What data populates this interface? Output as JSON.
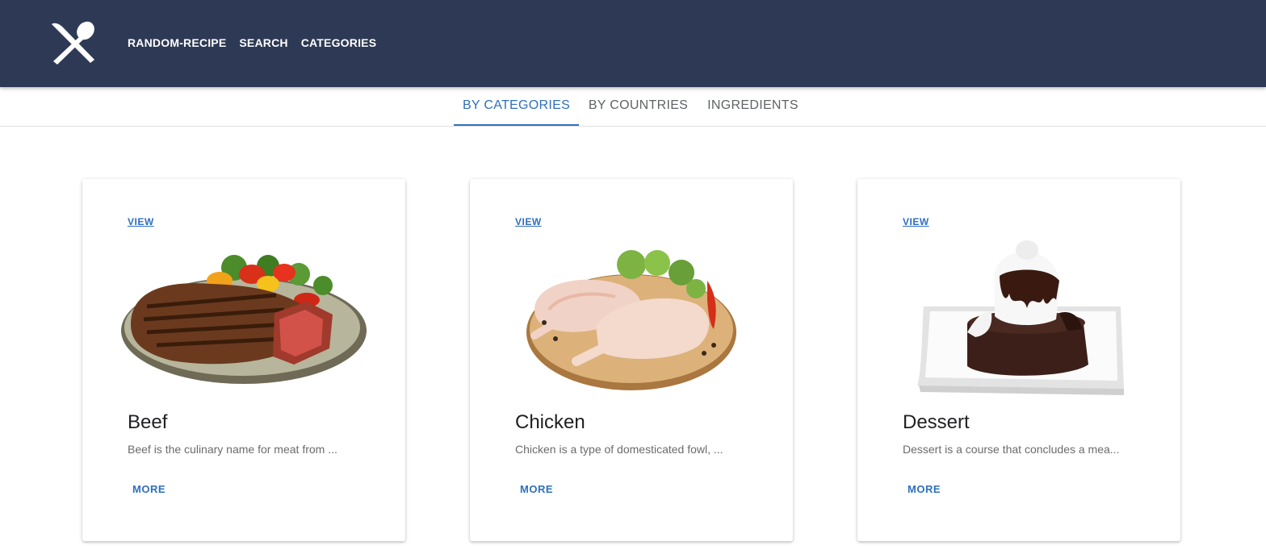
{
  "header": {
    "logo_icon": "fork-knife-icon",
    "nav": [
      "RANDOM-RECIPE",
      "SEARCH",
      "CATEGORIES"
    ]
  },
  "tabs": [
    {
      "label": "BY CATEGORIES",
      "active": true
    },
    {
      "label": "BY COUNTRIES",
      "active": false
    },
    {
      "label": "INGREDIENTS",
      "active": false
    }
  ],
  "cards": [
    {
      "view": "VIEW",
      "title": "Beef",
      "desc": "Beef is the culinary name for meat from ...",
      "more": "MORE"
    },
    {
      "view": "VIEW",
      "title": "Chicken",
      "desc": "Chicken is a type of domesticated fowl, ...",
      "more": "MORE"
    },
    {
      "view": "VIEW",
      "title": "Dessert",
      "desc": "Dessert is a course that concludes a mea...",
      "more": "MORE"
    }
  ],
  "colors": {
    "appbar": "#2e3a55",
    "accent": "#2f6fbd"
  }
}
